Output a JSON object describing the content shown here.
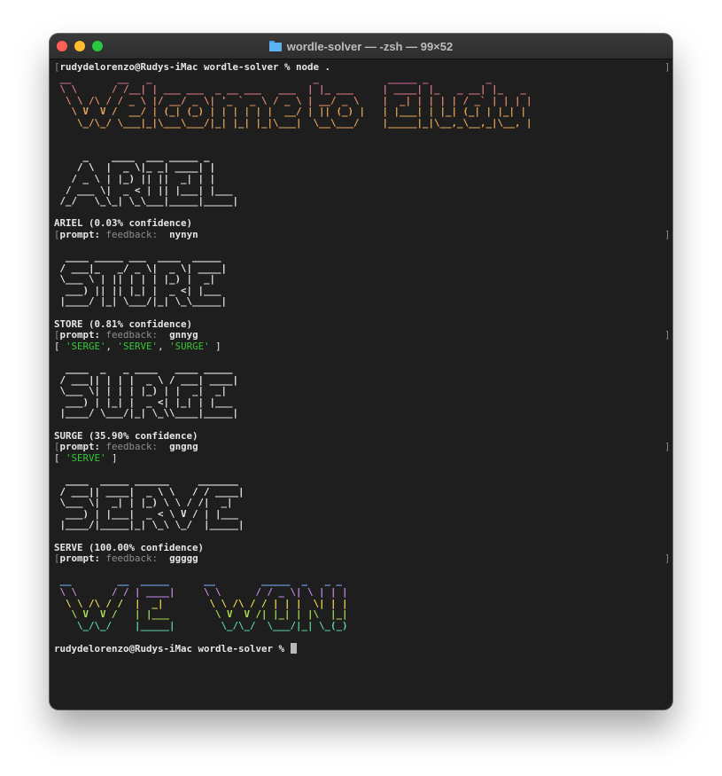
{
  "window": {
    "title": "wordle-solver — -zsh — 99×52"
  },
  "terminal": {
    "initial_prompt": "rudydelorenzo@Rudys-iMac wordle-solver % node .",
    "banner_welcome": [
      " __        __   _                            _            _____ _          _  ",
      " \\ \\      / /__| | ___ ___  _ __ ___   ___  | |_ ___     | ____| |_   _ __| |_   _ ",
      "  \\ \\ /\\ / / _ \\ |/ __/ _ \\| '_ ` _ \\ / _ \\ | __/ _ \\    |  _| | | | | / _` | | | |",
      "   \\ V  V /  __/ | (_| (_) | | | | | |  __/ | || (_) |   | |___| | |_| (_| | |_| |",
      "    \\_/\\_/ \\___|_|\\___\\___/|_| |_| |_|\\___|  \\__\\___/    |_____|_|\\__,_\\__,_|\\__, |"
    ],
    "rounds": [
      {
        "art": [
          "     _    ____  ___ _____ _     ",
          "    / \\  |  _ \\|_ _| ____| |    ",
          "   / _ \\ | |_) || ||  _| | |    ",
          "  / ___ \\|  _ < | || |___| |___ ",
          " /_/   \\_\\_| \\_\\___|_____|_____|"
        ],
        "confidence_line": "ARIEL (0.03% confidence)",
        "prompt_label": "prompt:",
        "feedback_label": "feedback:",
        "feedback_value": "nynyn",
        "candidates": []
      },
      {
        "art": [
          "  ____ _____ ___  ____  _____ ",
          " / ___|_   _/ _ \\|  _ \\| ____|",
          " \\___ \\ | || | | | |_) |  _|  ",
          "  ___) || || |_| |  _ <| |___ ",
          " |____/ |_| \\___/|_| \\_\\_____|"
        ],
        "confidence_line": "STORE (0.81% confidence)",
        "prompt_label": "prompt:",
        "feedback_label": "feedback:",
        "feedback_value": "gnnyg",
        "candidates": [
          "'SERGE'",
          "'SERVE'",
          "'SURGE'"
        ]
      },
      {
        "art": [
          "  ____  _   _ ____   ____ _____ ",
          " / ___|| | | |  _ \\ / ___| ____|",
          " \\___ \\| | | | |_) | |  _|  _|  ",
          "  ___) | |_| |  _ <| |_| | |___ ",
          " |____/ \\___/|_| \\_\\\\____|_____|"
        ],
        "confidence_line": "SURGE (35.90% confidence)",
        "prompt_label": "prompt:",
        "feedback_label": "feedback:",
        "feedback_value": "gngng",
        "candidates": [
          "'SERVE'"
        ]
      },
      {
        "art": [
          "  ____  _____ ______     _______ ",
          " / ___|| ____|  _ \\ \\   / / ____|",
          " \\___ \\|  _| | |_) \\ \\ / /|  _|  ",
          "  ___) | |___|  _ < \\ V / | |___ ",
          " |____/|_____|_| \\_\\ \\_/  |_____|"
        ],
        "confidence_line": "SERVE (100.00% confidence)",
        "prompt_label": "prompt:",
        "feedback_label": "feedback:",
        "feedback_value": "ggggg",
        "candidates": []
      }
    ],
    "banner_won": [
      " __        __  _____      __        _____  _   _ _ ",
      " \\ \\      / / | ____|     \\ \\      / / _ \\| \\ | | |",
      "  \\ \\ /\\ / /  |  _|        \\ \\ /\\ / / | | |  \\| | |",
      "   \\ V  V /   | |___        \\ V  V /| |_| | |\\  |_|",
      "    \\_/\\_/    |_____|        \\_/\\_/  \\___/|_| \\_(_)"
    ],
    "final_prompt": "rudydelorenzo@Rudys-iMac wordle-solver % ",
    "colors": {
      "background": "#1e1e1e",
      "text": "#e6e6e6",
      "dim_label": "#8e8e8e",
      "candidate_green": "#37c737",
      "welcome_gradient": [
        "#d06a9e",
        "#dd7b86",
        "#e88f6b",
        "#e8a65a"
      ],
      "art_gradient": [
        "#ffffff",
        "#f2f2f2",
        "#e4e4e4"
      ],
      "won_gradient": [
        "#7fb4ff",
        "#c28ce8",
        "#f2dd4a",
        "#a9de52",
        "#5dd6a0"
      ]
    }
  }
}
